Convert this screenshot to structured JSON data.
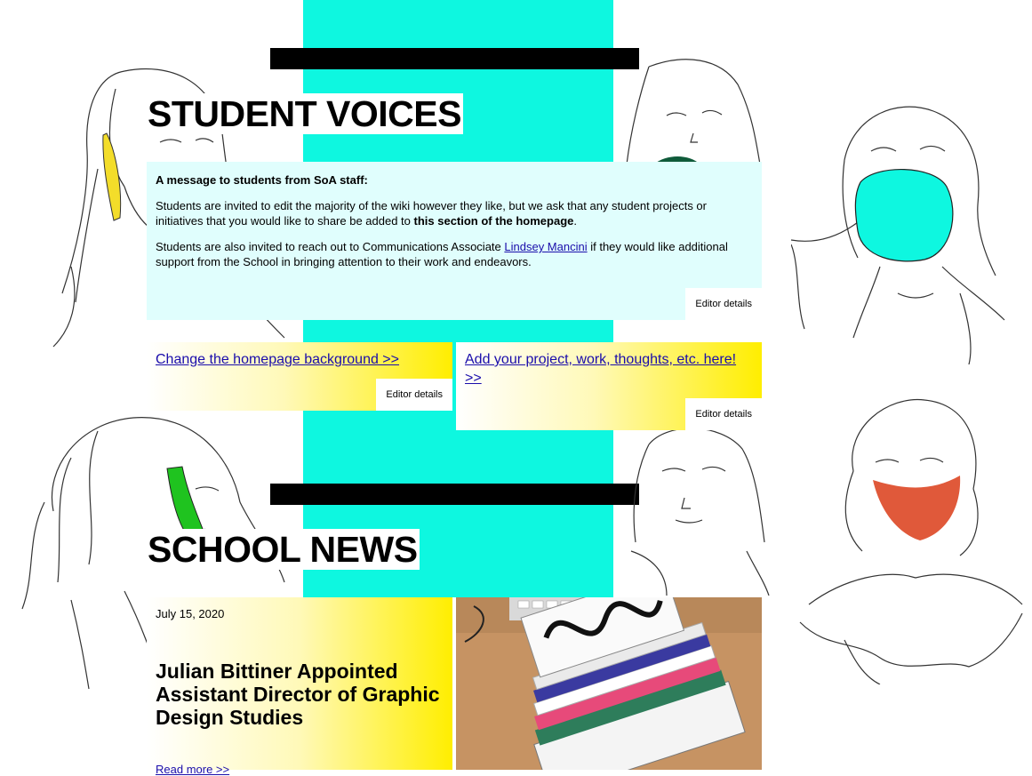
{
  "student_voices": {
    "title": "STUDENT VOICES",
    "message_heading": "A message to students from SoA staff:",
    "paragraph1_text": "Students are invited to edit the majority of the wiki however they like, but we ask that any student projects or initiatives that you would like to share be added to ",
    "paragraph1_bold": "this section of the homepage",
    "paragraph1_end": ".",
    "paragraph2_text": "Students are also invited to reach out to Communications Associate ",
    "paragraph2_link": "Lindsey Mancini",
    "paragraph2_end": " if they would like additional support from the School in bringing attention to their work and endeavors.",
    "editor_details": "Editor details"
  },
  "cards": [
    {
      "link": "Change the homepage background >>",
      "editor_details": "Editor details"
    },
    {
      "link": "Add your project, work, thoughts, etc. here! >>",
      "editor_details": "Editor details"
    }
  ],
  "school_news": {
    "title": "SCHOOL NEWS",
    "date": "July 15, 2020",
    "headline": "Julian Bittiner Appointed Assistant Director of Graphic Design Studies",
    "read_more": "Read more >>"
  },
  "colors": {
    "stripe": "#0ef7e0",
    "message_bg": "#e0fefd",
    "gradient_end": "#ffee00",
    "mask_cyan": "#0ef7e0",
    "mask_orange": "#e0593a",
    "phone_yellow": "#f3dd2a",
    "phone_green": "#1fc31f",
    "link": "#1a0dab"
  }
}
